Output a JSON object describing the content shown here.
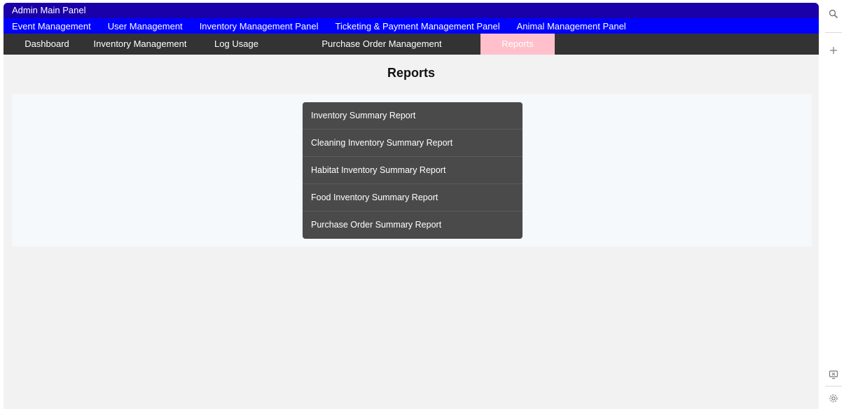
{
  "app": {
    "title": "Admin Main Panel"
  },
  "panel_nav": [
    {
      "label": "Event Management"
    },
    {
      "label": "User Management"
    },
    {
      "label": "Inventory Management Panel"
    },
    {
      "label": "Ticketing & Payment Management Panel"
    },
    {
      "label": "Animal Management Panel"
    }
  ],
  "sub_nav": [
    {
      "label": "Dashboard",
      "active": false
    },
    {
      "label": "Inventory Management",
      "active": false
    },
    {
      "label": "Log Usage",
      "active": false
    },
    {
      "label": "Purchase Order Management",
      "active": false
    },
    {
      "label": "Reports",
      "active": true
    }
  ],
  "main": {
    "title": "Reports",
    "reports": [
      {
        "label": "Inventory Summary Report"
      },
      {
        "label": "Cleaning Inventory Summary Report"
      },
      {
        "label": "Habitat Inventory Summary Report"
      },
      {
        "label": "Food Inventory Summary Report"
      },
      {
        "label": "Purchase Order Summary Report"
      }
    ]
  },
  "sidebar_icons": [
    "search-icon",
    "plus-icon",
    "screen-share-icon",
    "settings-icon"
  ],
  "colors": {
    "title_bar": "#1a00a8",
    "panel_nav": "#0000ff",
    "sub_nav": "#333333",
    "active_tab": "#ffc0cb",
    "report_menu": "#4a4a4a"
  }
}
